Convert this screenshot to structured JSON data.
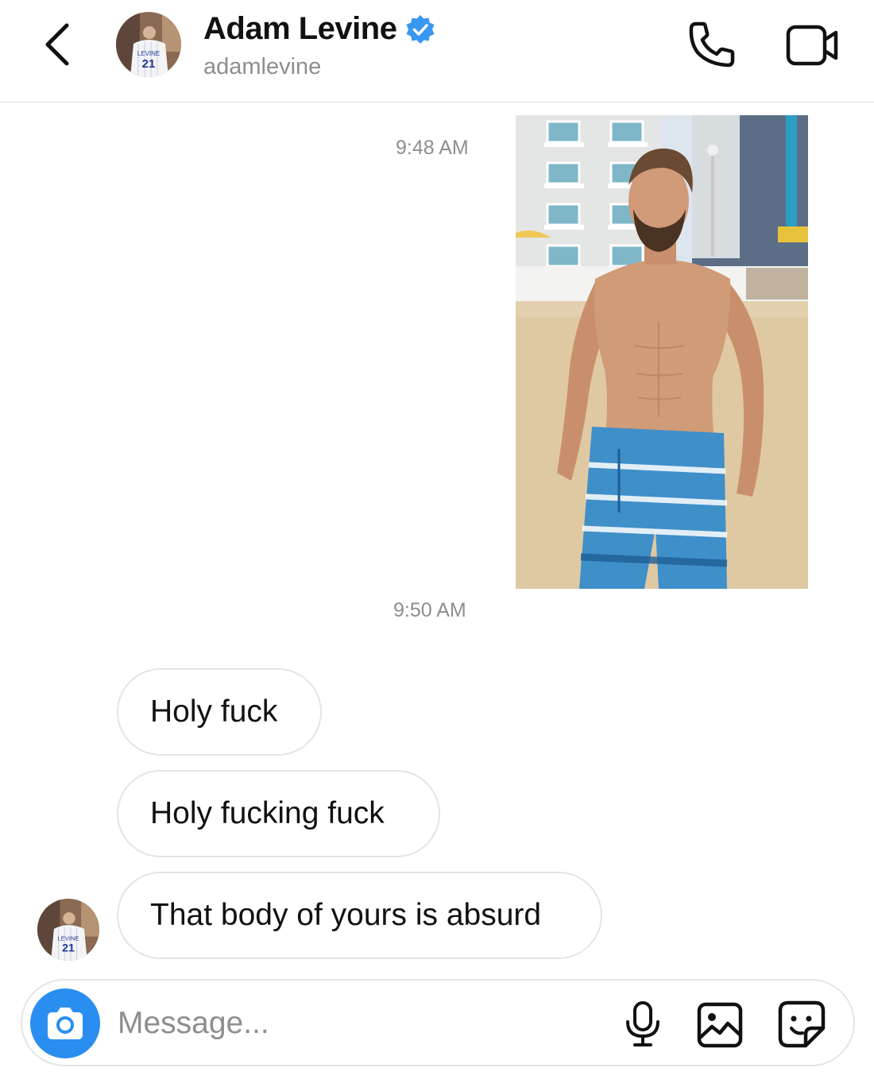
{
  "header": {
    "name": "Adam Levine",
    "username": "adamlevine",
    "verified": true,
    "icons": {
      "back": "chevron-left-icon",
      "verified": "verified-badge-icon",
      "call": "phone-icon",
      "video": "video-camera-icon"
    }
  },
  "avatar": {
    "jersey_name": "LEVINE",
    "jersey_number": "21"
  },
  "thread": {
    "items": [
      {
        "type": "timestamp",
        "text": "9:48 AM"
      },
      {
        "type": "photo",
        "sender": "me",
        "description_icon": "beach-photo"
      },
      {
        "type": "timestamp",
        "text": "9:50 AM"
      },
      {
        "type": "message",
        "sender": "them",
        "text": "Holy fuck"
      },
      {
        "type": "message",
        "sender": "them",
        "text": "Holy fucking fuck"
      },
      {
        "type": "message",
        "sender": "them",
        "text": "That body of yours is absurd"
      }
    ]
  },
  "composer": {
    "placeholder": "Message...",
    "value": "",
    "icons": [
      "camera-icon",
      "microphone-icon",
      "gallery-icon",
      "sticker-icon"
    ]
  },
  "colors": {
    "accent_blue": "#2a8ef0",
    "verified_blue": "#3897f0",
    "muted_text": "#8e8e8e",
    "bubble_border": "#e4e4e4"
  }
}
